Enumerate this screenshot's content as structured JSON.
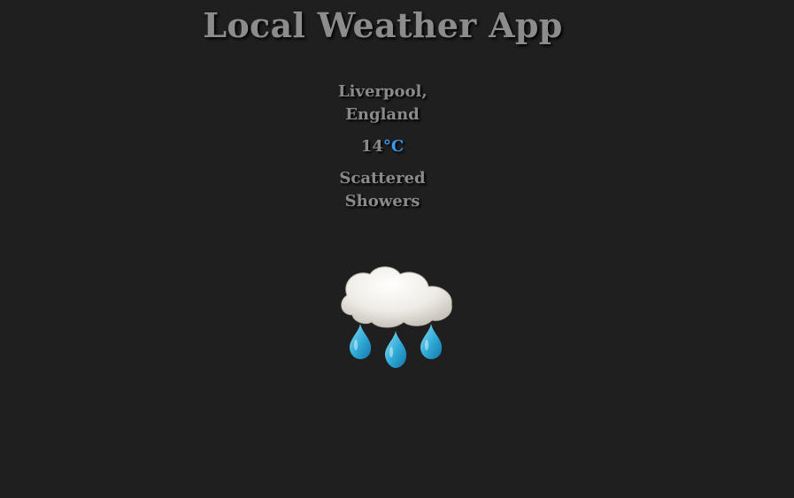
{
  "app": {
    "title": "Local Weather App"
  },
  "location": {
    "city": "Liverpool,",
    "country": "England"
  },
  "weather": {
    "temperature": "14",
    "unit": "°C",
    "condition_line1": "Scattered",
    "condition_line2": "Showers",
    "icon": "cloud-rain-icon"
  },
  "colors": {
    "background": "#1f1f1f",
    "text": "#8a8a8a",
    "unit_accent": "#3b96f2",
    "raindrop": "#2ea9d6"
  }
}
